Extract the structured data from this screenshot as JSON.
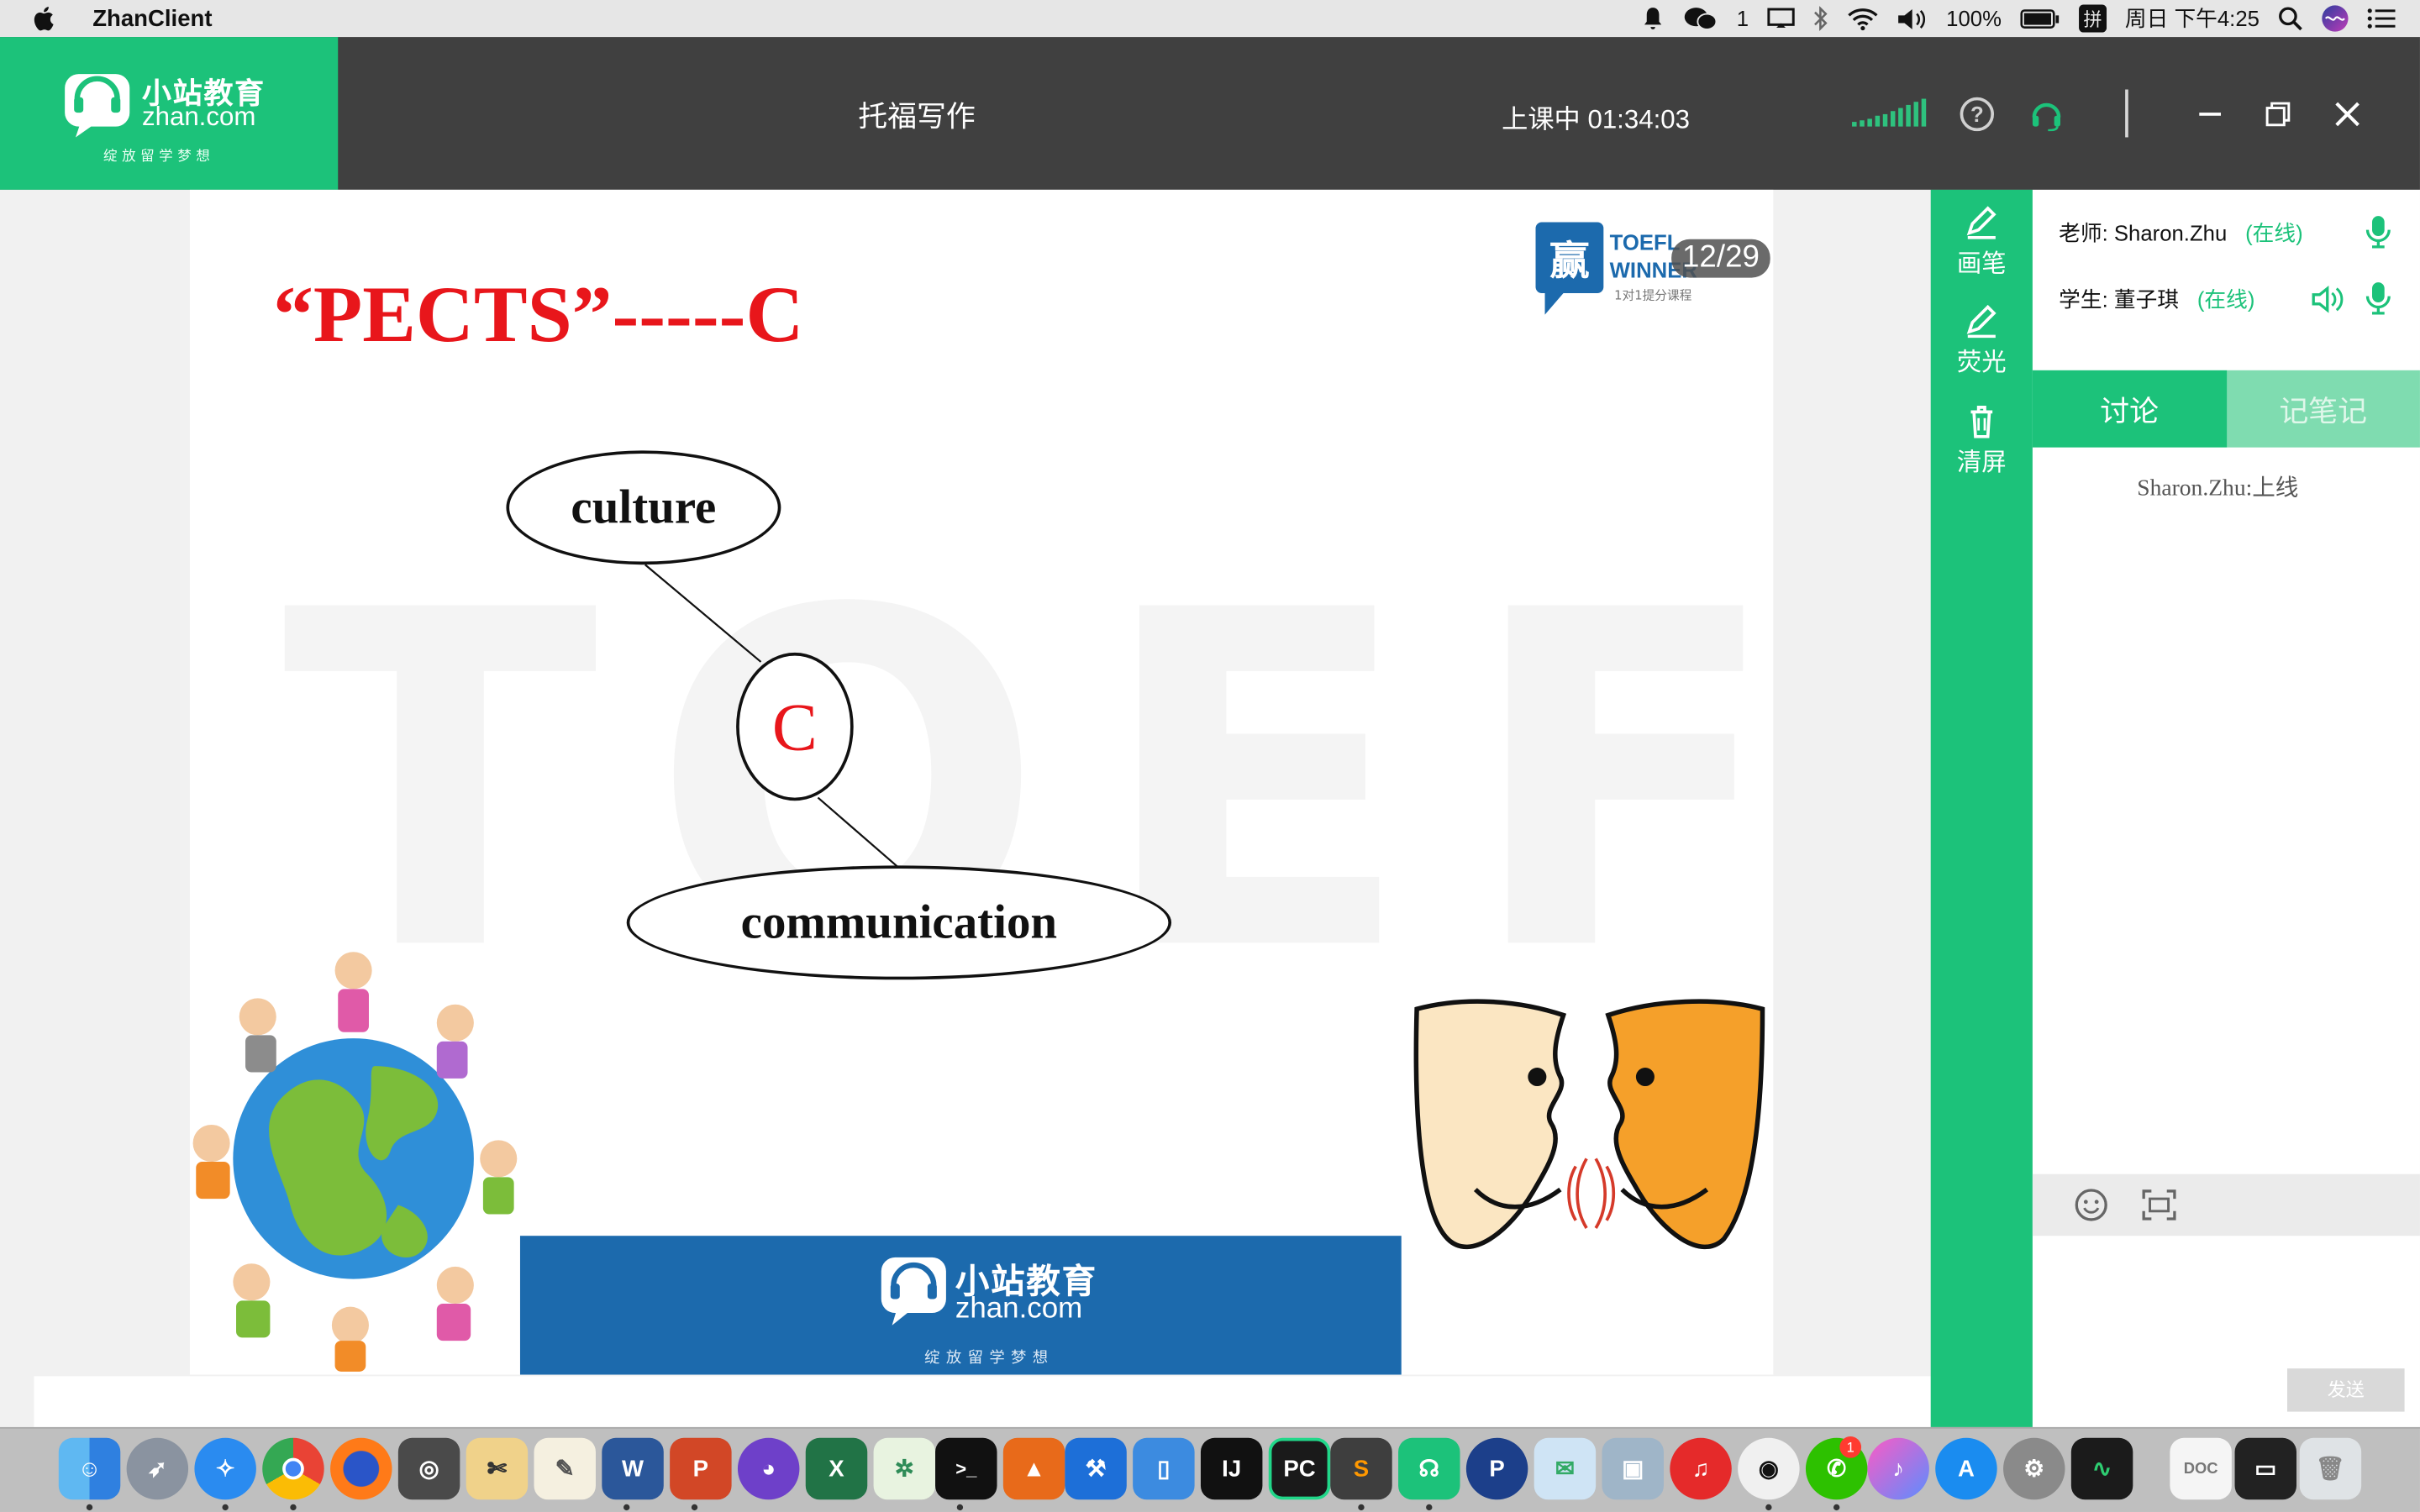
{
  "menubar": {
    "app_name": "ZhanClient",
    "wechat_count": "1",
    "battery": "100%",
    "clock": "周日 下午4:25"
  },
  "titlebar": {
    "logo_cn": "小站教育",
    "logo_en": "zhan.com",
    "logo_slogan": "绽放留学梦想",
    "course_title": "托福写作",
    "class_status": "上课中 01:34:03",
    "signal_level": 1.0
  },
  "slide": {
    "watermark": "TOEFL",
    "heading": "“PECTS”-----C",
    "node_top": "culture",
    "node_center": "C",
    "node_bottom": "communication",
    "badge_line1": "TOEFL",
    "badge_line2": "WINNER",
    "badge_sub": "1对1提分课程",
    "page_counter": "12/29",
    "banner_cn": "小站教育",
    "banner_en": "zhan.com",
    "banner_slogan": "绽放留学梦想"
  },
  "tools": {
    "pen": "画笔",
    "highlight": "荧光",
    "clear": "清屏"
  },
  "panel": {
    "teacher_label": "老师:",
    "teacher_name": "Sharon.Zhu",
    "teacher_status": "(在线)",
    "student_label": "学生:",
    "student_name": "董子琪",
    "student_status": "(在线)",
    "tab_discuss": "讨论",
    "tab_notes": "记笔记",
    "chat_message": "Sharon.Zhu:上线",
    "send_label": "发送"
  },
  "colors": {
    "brand_green": "#1cc27a",
    "titlebar_bg": "#404040",
    "heading_red": "#e8161b",
    "banner_blue": "#1c6aad"
  },
  "dock": {
    "apps": [
      "Finder",
      "Launchpad",
      "Safari",
      "Chrome",
      "Firefox",
      "Disk Utility",
      "Preview",
      "TextEdit",
      "Word",
      "PowerPoint",
      "GitHub Desktop",
      "Excel",
      "XMind",
      "Terminal",
      "MATLAB",
      "Xcode",
      "Simulator",
      "IntelliJ IDEA",
      "PyCharm",
      "Sublime Text",
      "ZhanClient",
      "TPO",
      "Mail Sender",
      "Image Capture",
      "NetEase Music",
      "QQ",
      "WeChat",
      "iTunes",
      "App Store",
      "System Preferences",
      "Activity Monitor",
      "Document",
      "Terminal Window",
      "Trash"
    ],
    "labels": {
      "word": "W",
      "powerpoint": "P",
      "excel": "X",
      "terminal": ">_",
      "intellij": "IJ",
      "pycharm": "PC",
      "tpo": "P",
      "wechat_badge": "1"
    }
  }
}
